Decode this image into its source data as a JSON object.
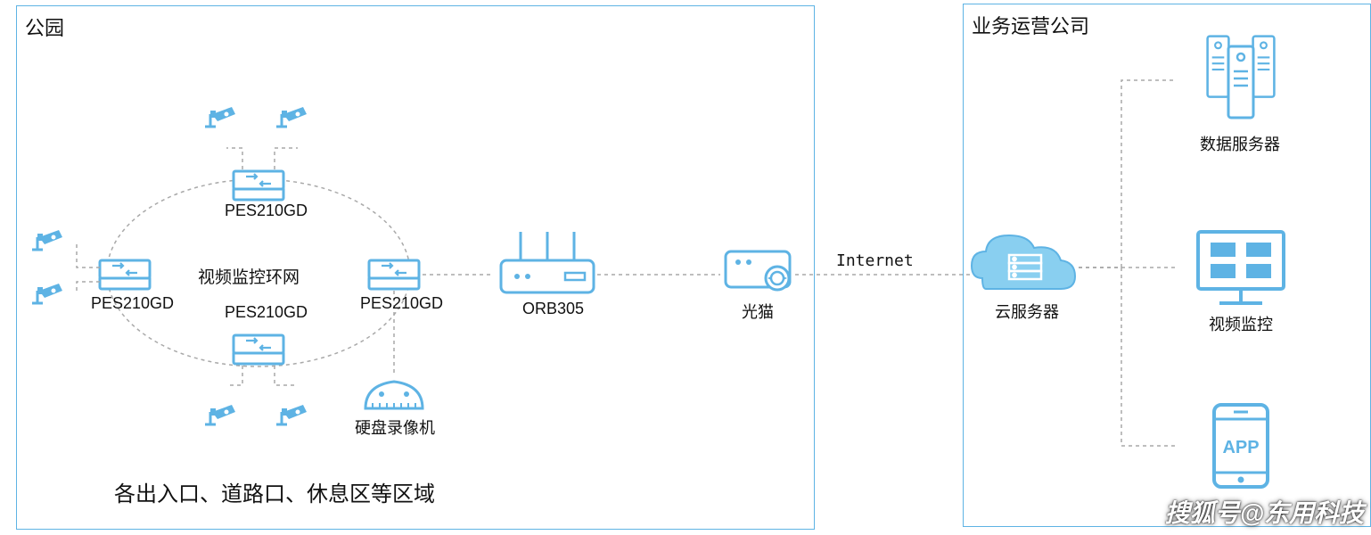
{
  "park": {
    "title": "公园",
    "ring_label": "视频监控环网",
    "switch_label": "PES210GD",
    "router_label": "ORB305",
    "modem_label": "光猫",
    "dvr_label": "硬盘录像机",
    "area_caption": "各出入口、道路口、休息区等区域"
  },
  "internet_label": "Internet",
  "cloud_label": "云服务器",
  "company": {
    "title": "业务运营公司",
    "server_label": "数据服务器",
    "monitor_label": "视频监控",
    "app_label": "APP"
  },
  "watermark": "搜狐号@东用科技",
  "colors": {
    "line": "#5EB3E4",
    "dash": "#A9A9A9"
  }
}
